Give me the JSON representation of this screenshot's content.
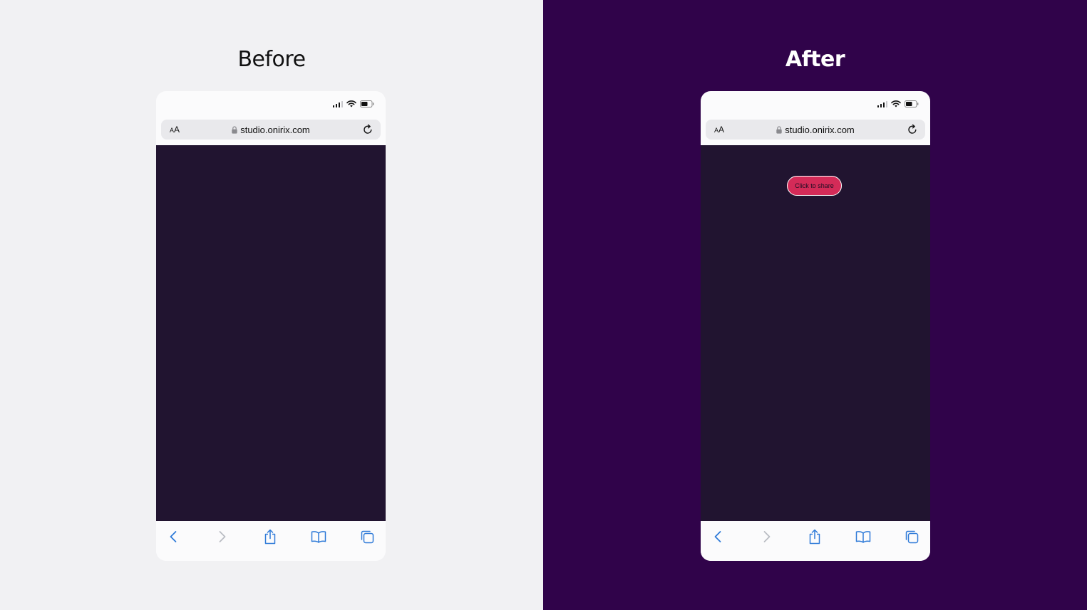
{
  "panels": {
    "before": {
      "title": "Before",
      "browser": {
        "text_size_label_small": "A",
        "text_size_label_large": "A",
        "url": "studio.onirix.com",
        "content_bg": "#211430"
      }
    },
    "after": {
      "title": "After",
      "browser": {
        "text_size_label_small": "A",
        "text_size_label_large": "A",
        "url": "studio.onirix.com",
        "content_bg": "#211430",
        "share_button_label": "Click to share",
        "share_button_color": "#d42b58"
      }
    }
  },
  "colors": {
    "left_background": "#f1f1f3",
    "right_background": "#30034a",
    "ios_tint": "#2f7bd8"
  },
  "icons": {
    "status": [
      "signal-icon",
      "wifi-icon",
      "battery-icon"
    ],
    "url_bar": [
      "lock-icon",
      "reload-icon"
    ],
    "toolbar": [
      "back-icon",
      "forward-icon",
      "share-icon",
      "bookmarks-icon",
      "tabs-icon"
    ]
  }
}
